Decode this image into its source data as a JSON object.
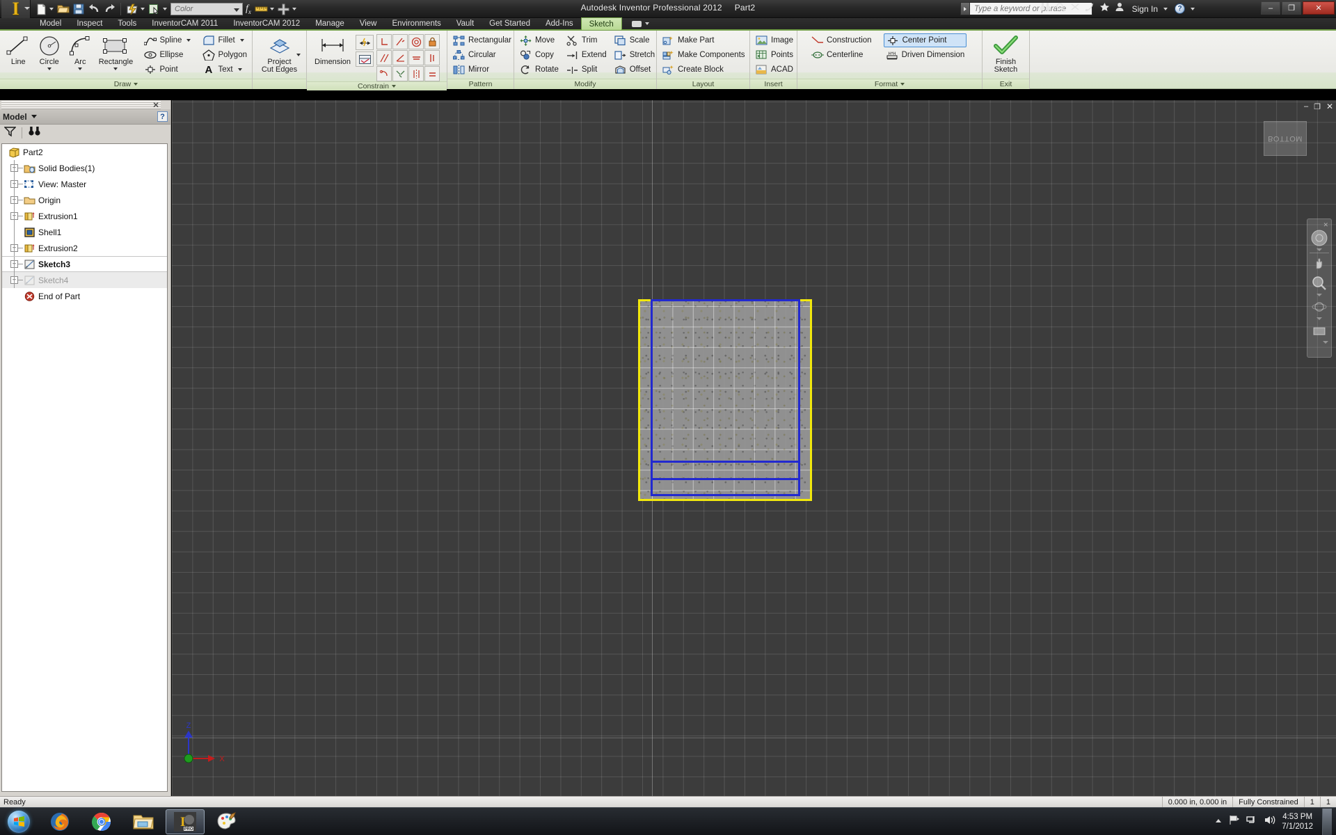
{
  "titlebar": {
    "app_title": "Autodesk Inventor Professional 2012",
    "document": "Part2",
    "logo_text": "I",
    "logo_badge": "PRO",
    "color_combo_value": "Color",
    "search_placeholder": "Type a keyword or phrase",
    "signin_label": "Sign In",
    "help_label": "?",
    "minimize_label": "–",
    "restore_label": "❐",
    "close_label": "✕",
    "qat": [
      {
        "name": "new-document",
        "label": "New"
      },
      {
        "name": "open-document",
        "label": "Open"
      },
      {
        "name": "save-document",
        "label": "Save"
      },
      {
        "name": "undo",
        "label": "Undo"
      },
      {
        "name": "redo",
        "label": "Redo"
      },
      {
        "name": "update",
        "label": "Update"
      },
      {
        "name": "select",
        "label": "Select"
      },
      {
        "name": "parameters",
        "label": "Parameters"
      },
      {
        "name": "measure",
        "label": "Measure"
      },
      {
        "name": "material",
        "label": "Material"
      }
    ]
  },
  "tabs": [
    {
      "label": "Model",
      "active": false
    },
    {
      "label": "Inspect",
      "active": false
    },
    {
      "label": "Tools",
      "active": false
    },
    {
      "label": "InventorCAM 2011",
      "active": false
    },
    {
      "label": "InventorCAM 2012",
      "active": false
    },
    {
      "label": "Manage",
      "active": false
    },
    {
      "label": "View",
      "active": false
    },
    {
      "label": "Environments",
      "active": false
    },
    {
      "label": "Vault",
      "active": false
    },
    {
      "label": "Get Started",
      "active": false
    },
    {
      "label": "Add-Ins",
      "active": false
    },
    {
      "label": "Sketch",
      "active": true
    }
  ],
  "ribbon": {
    "panels": [
      {
        "name": "draw",
        "title": "Draw",
        "big_buttons": [
          {
            "label": "Line",
            "icon": "line-icon",
            "has_dropdown": false
          },
          {
            "label": "Circle",
            "icon": "circle-icon",
            "has_dropdown": true
          },
          {
            "label": "Arc",
            "icon": "arc-icon",
            "has_dropdown": true
          },
          {
            "label": "Rectangle",
            "icon": "rectangle-icon",
            "has_dropdown": true
          }
        ],
        "small_col_1": [
          {
            "label": "Spline",
            "icon": "spline-icon",
            "has_dropdown": true
          },
          {
            "label": "Ellipse",
            "icon": "ellipse-icon",
            "has_dropdown": false
          },
          {
            "label": "Point",
            "icon": "point-icon",
            "has_dropdown": false
          }
        ],
        "small_col_2": [
          {
            "label": "Fillet",
            "icon": "fillet-icon",
            "has_dropdown": true
          },
          {
            "label": "Polygon",
            "icon": "polygon-icon",
            "has_dropdown": false
          },
          {
            "label": "Text",
            "icon": "text-icon",
            "has_dropdown": true
          }
        ]
      },
      {
        "name": "project",
        "title": "",
        "big_buttons": [
          {
            "label": "Project\nCut Edges",
            "icon": "project-cut-edges-icon",
            "has_dropdown": true
          }
        ]
      },
      {
        "name": "constrain",
        "title": "Constrain",
        "big_buttons": [
          {
            "label": "Dimension",
            "icon": "dimension-icon",
            "has_dropdown": false
          }
        ],
        "constraint_icons": [
          "perpendicular-constraint-icon",
          "parallel-constraint-icon",
          "tangent-constraint-icon",
          "coincident-constraint-icon",
          "concentric-constraint-icon",
          "collinear-constraint-icon",
          "horizontal-constraint-icon",
          "vertical-constraint-icon",
          "equal-constraint-icon",
          "fix-constraint-icon",
          "symmetric-constraint-icon",
          "smooth-constraint-icon"
        ]
      },
      {
        "name": "pattern",
        "title": "Pattern",
        "small_col_1": [
          {
            "label": "Rectangular",
            "icon": "rectangular-pattern-icon",
            "has_dropdown": false
          },
          {
            "label": "Circular",
            "icon": "circular-pattern-icon",
            "has_dropdown": false
          },
          {
            "label": "Mirror",
            "icon": "mirror-icon",
            "has_dropdown": false
          }
        ]
      },
      {
        "name": "modify",
        "title": "Modify",
        "small_col_1": [
          {
            "label": "Move",
            "icon": "move-icon",
            "has_dropdown": false
          },
          {
            "label": "Copy",
            "icon": "copy-icon",
            "has_dropdown": false
          },
          {
            "label": "Rotate",
            "icon": "rotate-icon",
            "has_dropdown": false
          }
        ],
        "small_col_2": [
          {
            "label": "Trim",
            "icon": "trim-icon",
            "has_dropdown": false
          },
          {
            "label": "Extend",
            "icon": "extend-icon",
            "has_dropdown": false
          },
          {
            "label": "Split",
            "icon": "split-icon",
            "has_dropdown": false
          }
        ],
        "small_col_3": [
          {
            "label": "Scale",
            "icon": "scale-icon",
            "has_dropdown": false
          },
          {
            "label": "Stretch",
            "icon": "stretch-icon",
            "has_dropdown": false
          },
          {
            "label": "Offset",
            "icon": "offset-icon",
            "has_dropdown": false
          }
        ]
      },
      {
        "name": "layout",
        "title": "Layout",
        "small_col_1": [
          {
            "label": "Make Part",
            "icon": "make-part-icon",
            "has_dropdown": false
          },
          {
            "label": "Make Components",
            "icon": "make-components-icon",
            "has_dropdown": false
          },
          {
            "label": "Create Block",
            "icon": "create-block-icon",
            "has_dropdown": false
          }
        ]
      },
      {
        "name": "insert",
        "title": "Insert",
        "small_col_1": [
          {
            "label": "Image",
            "icon": "image-icon",
            "has_dropdown": false
          },
          {
            "label": "Points",
            "icon": "points-icon",
            "has_dropdown": false
          },
          {
            "label": "ACAD",
            "icon": "acad-icon",
            "has_dropdown": false
          }
        ]
      },
      {
        "name": "format",
        "title": "Format",
        "small_col_1": [
          {
            "label": "Construction",
            "icon": "construction-icon",
            "has_dropdown": false
          },
          {
            "label": "Centerline",
            "icon": "centerline-icon",
            "has_dropdown": false
          }
        ],
        "small_col_2": [
          {
            "label": "Center Point",
            "icon": "center-point-icon",
            "has_dropdown": false,
            "selected": true
          },
          {
            "label": "Driven Dimension",
            "icon": "driven-dimension-icon",
            "has_dropdown": false
          }
        ]
      },
      {
        "name": "exit",
        "title": "Exit",
        "big_buttons": [
          {
            "label": "Finish\nSketch",
            "icon": "finish-sketch-icon",
            "has_dropdown": false
          }
        ]
      }
    ]
  },
  "browser": {
    "panel_title": "Model",
    "help_label": "?",
    "close_label": "✕",
    "tools": [
      {
        "name": "filter-icon",
        "label": "Filter"
      },
      {
        "name": "find-icon",
        "label": "Find"
      }
    ],
    "tree": [
      {
        "label": "Part2",
        "icon": "part-icon",
        "depth": 0,
        "expander": "",
        "bold": false,
        "dim": false
      },
      {
        "label": "Solid Bodies(1)",
        "icon": "solid-bodies-icon",
        "depth": 1,
        "expander": "+",
        "bold": false,
        "dim": false
      },
      {
        "label": "View: Master",
        "icon": "view-master-icon",
        "depth": 1,
        "expander": "+",
        "bold": false,
        "dim": false
      },
      {
        "label": "Origin",
        "icon": "origin-folder-icon",
        "depth": 1,
        "expander": "+",
        "bold": false,
        "dim": false
      },
      {
        "label": "Extrusion1",
        "icon": "extrusion-icon",
        "depth": 1,
        "expander": "+",
        "bold": false,
        "dim": false
      },
      {
        "label": "Shell1",
        "icon": "shell-icon",
        "depth": 1,
        "expander": "",
        "bold": false,
        "dim": false
      },
      {
        "label": "Extrusion2",
        "icon": "extrusion-icon",
        "depth": 1,
        "expander": "+",
        "bold": false,
        "dim": false
      },
      {
        "label": "Sketch3",
        "icon": "sketch-icon",
        "depth": 1,
        "expander": "+",
        "bold": true,
        "dim": false
      },
      {
        "label": "Sketch4",
        "icon": "sketch-icon",
        "depth": 1,
        "expander": "+",
        "bold": false,
        "dim": true
      },
      {
        "label": "End of Part",
        "icon": "end-of-part-icon",
        "depth": 1,
        "expander": "",
        "bold": false,
        "dim": false
      }
    ]
  },
  "viewport": {
    "viewcube_label": "BOTTOM",
    "axis_x_label": "X",
    "axis_z_label": "Z",
    "navbar_items": [
      {
        "name": "steering-wheel-icon"
      },
      {
        "name": "pan-icon"
      },
      {
        "name": "zoom-icon"
      },
      {
        "name": "orbit-icon"
      },
      {
        "name": "look-at-icon"
      }
    ],
    "geometry": {
      "face_color": "#9c9c9c",
      "projected_edge_color": "#f2e80c",
      "sketch_edge_color": "#2229cf"
    },
    "vp_controls": {
      "minimize_label": "–",
      "restore_label": "❐",
      "close_label": "✕"
    }
  },
  "statusbar": {
    "message": "Ready",
    "coordinates": "0.000 in, 0.000 in",
    "constraint_status": "Fully Constrained",
    "count_1": "1",
    "count_2": "1"
  },
  "taskbar": {
    "start_label": "Start",
    "items": [
      {
        "name": "taskbar-firefox",
        "label": "Mozilla Firefox",
        "active": false
      },
      {
        "name": "taskbar-chrome",
        "label": "Google Chrome",
        "active": false
      },
      {
        "name": "taskbar-explorer",
        "label": "Windows Explorer",
        "active": false
      },
      {
        "name": "taskbar-inventor",
        "label": "Autodesk Inventor Professional 2012",
        "active": true
      },
      {
        "name": "taskbar-paint",
        "label": "Paint",
        "active": false
      }
    ],
    "tray": {
      "time": "4:53 PM",
      "date": "7/1/2012"
    }
  }
}
